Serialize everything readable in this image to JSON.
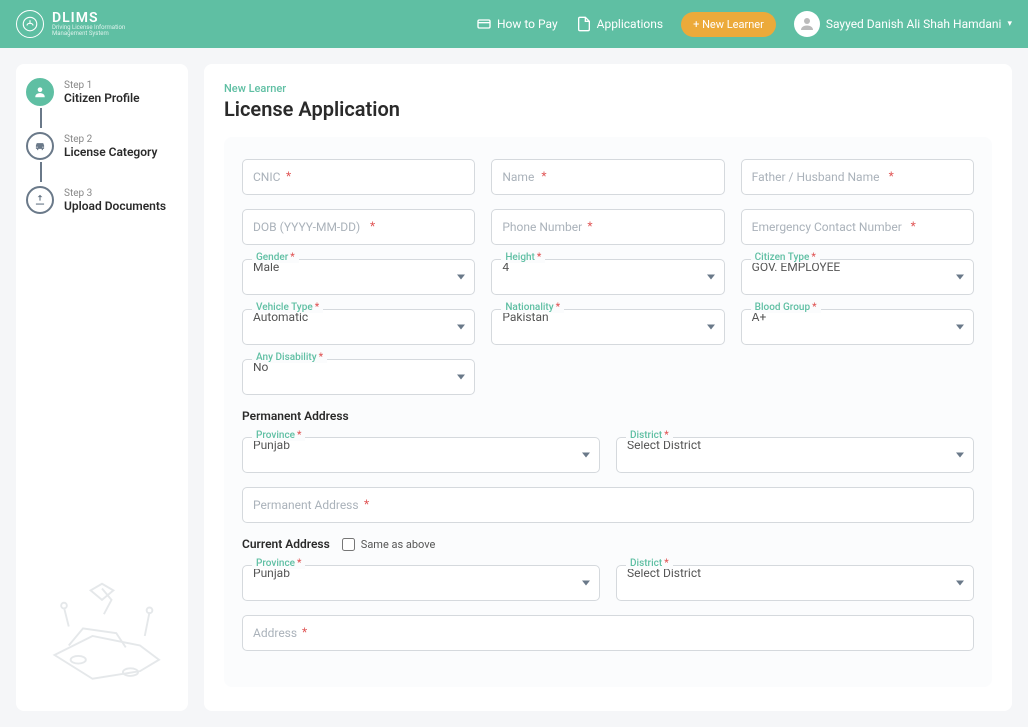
{
  "header": {
    "brand_title": "DLIMS",
    "brand_sub1": "Driving License Information",
    "brand_sub2": "Management System",
    "nav_how_to_pay": "How to Pay",
    "nav_applications": "Applications",
    "nav_new_learner": "+ New Learner",
    "user_name": "Sayyed Danish Ali Shah Hamdani"
  },
  "steps": [
    {
      "label": "Step 1",
      "title": "Citizen Profile"
    },
    {
      "label": "Step 2",
      "title": "License Category"
    },
    {
      "label": "Step 3",
      "title": "Upload Documents"
    }
  ],
  "page": {
    "breadcrumb": "New Learner",
    "title": "License Application"
  },
  "form": {
    "cnic_placeholder": "CNIC",
    "name_placeholder": "Name",
    "father_placeholder": "Father / Husband Name",
    "dob_placeholder": "DOB (YYYY-MM-DD)",
    "phone_placeholder": "Phone Number",
    "emerg_placeholder": "Emergency Contact Number",
    "gender": {
      "label": "Gender",
      "value": "Male"
    },
    "height": {
      "label": "Height",
      "value": "4"
    },
    "citizen_type": {
      "label": "Citizen Type",
      "value": "GOV. EMPLOYEE"
    },
    "vehicle_type": {
      "label": "Vehicle Type",
      "value": "Automatic"
    },
    "nationality": {
      "label": "Nationality",
      "value": "Pakistan"
    },
    "blood_group": {
      "label": "Blood Group",
      "value": "A+"
    },
    "disability": {
      "label": "Any Disability",
      "value": "No"
    },
    "perm_heading": "Permanent Address",
    "perm_province": {
      "label": "Province",
      "value": "Punjab"
    },
    "perm_district": {
      "label": "District",
      "value": "Select District"
    },
    "perm_address_placeholder": "Permanent Address",
    "curr_heading": "Current Address",
    "same_as_above": "Same as above",
    "curr_province": {
      "label": "Province",
      "value": "Punjab"
    },
    "curr_district": {
      "label": "District",
      "value": "Select District"
    },
    "curr_address_placeholder": "Address"
  }
}
